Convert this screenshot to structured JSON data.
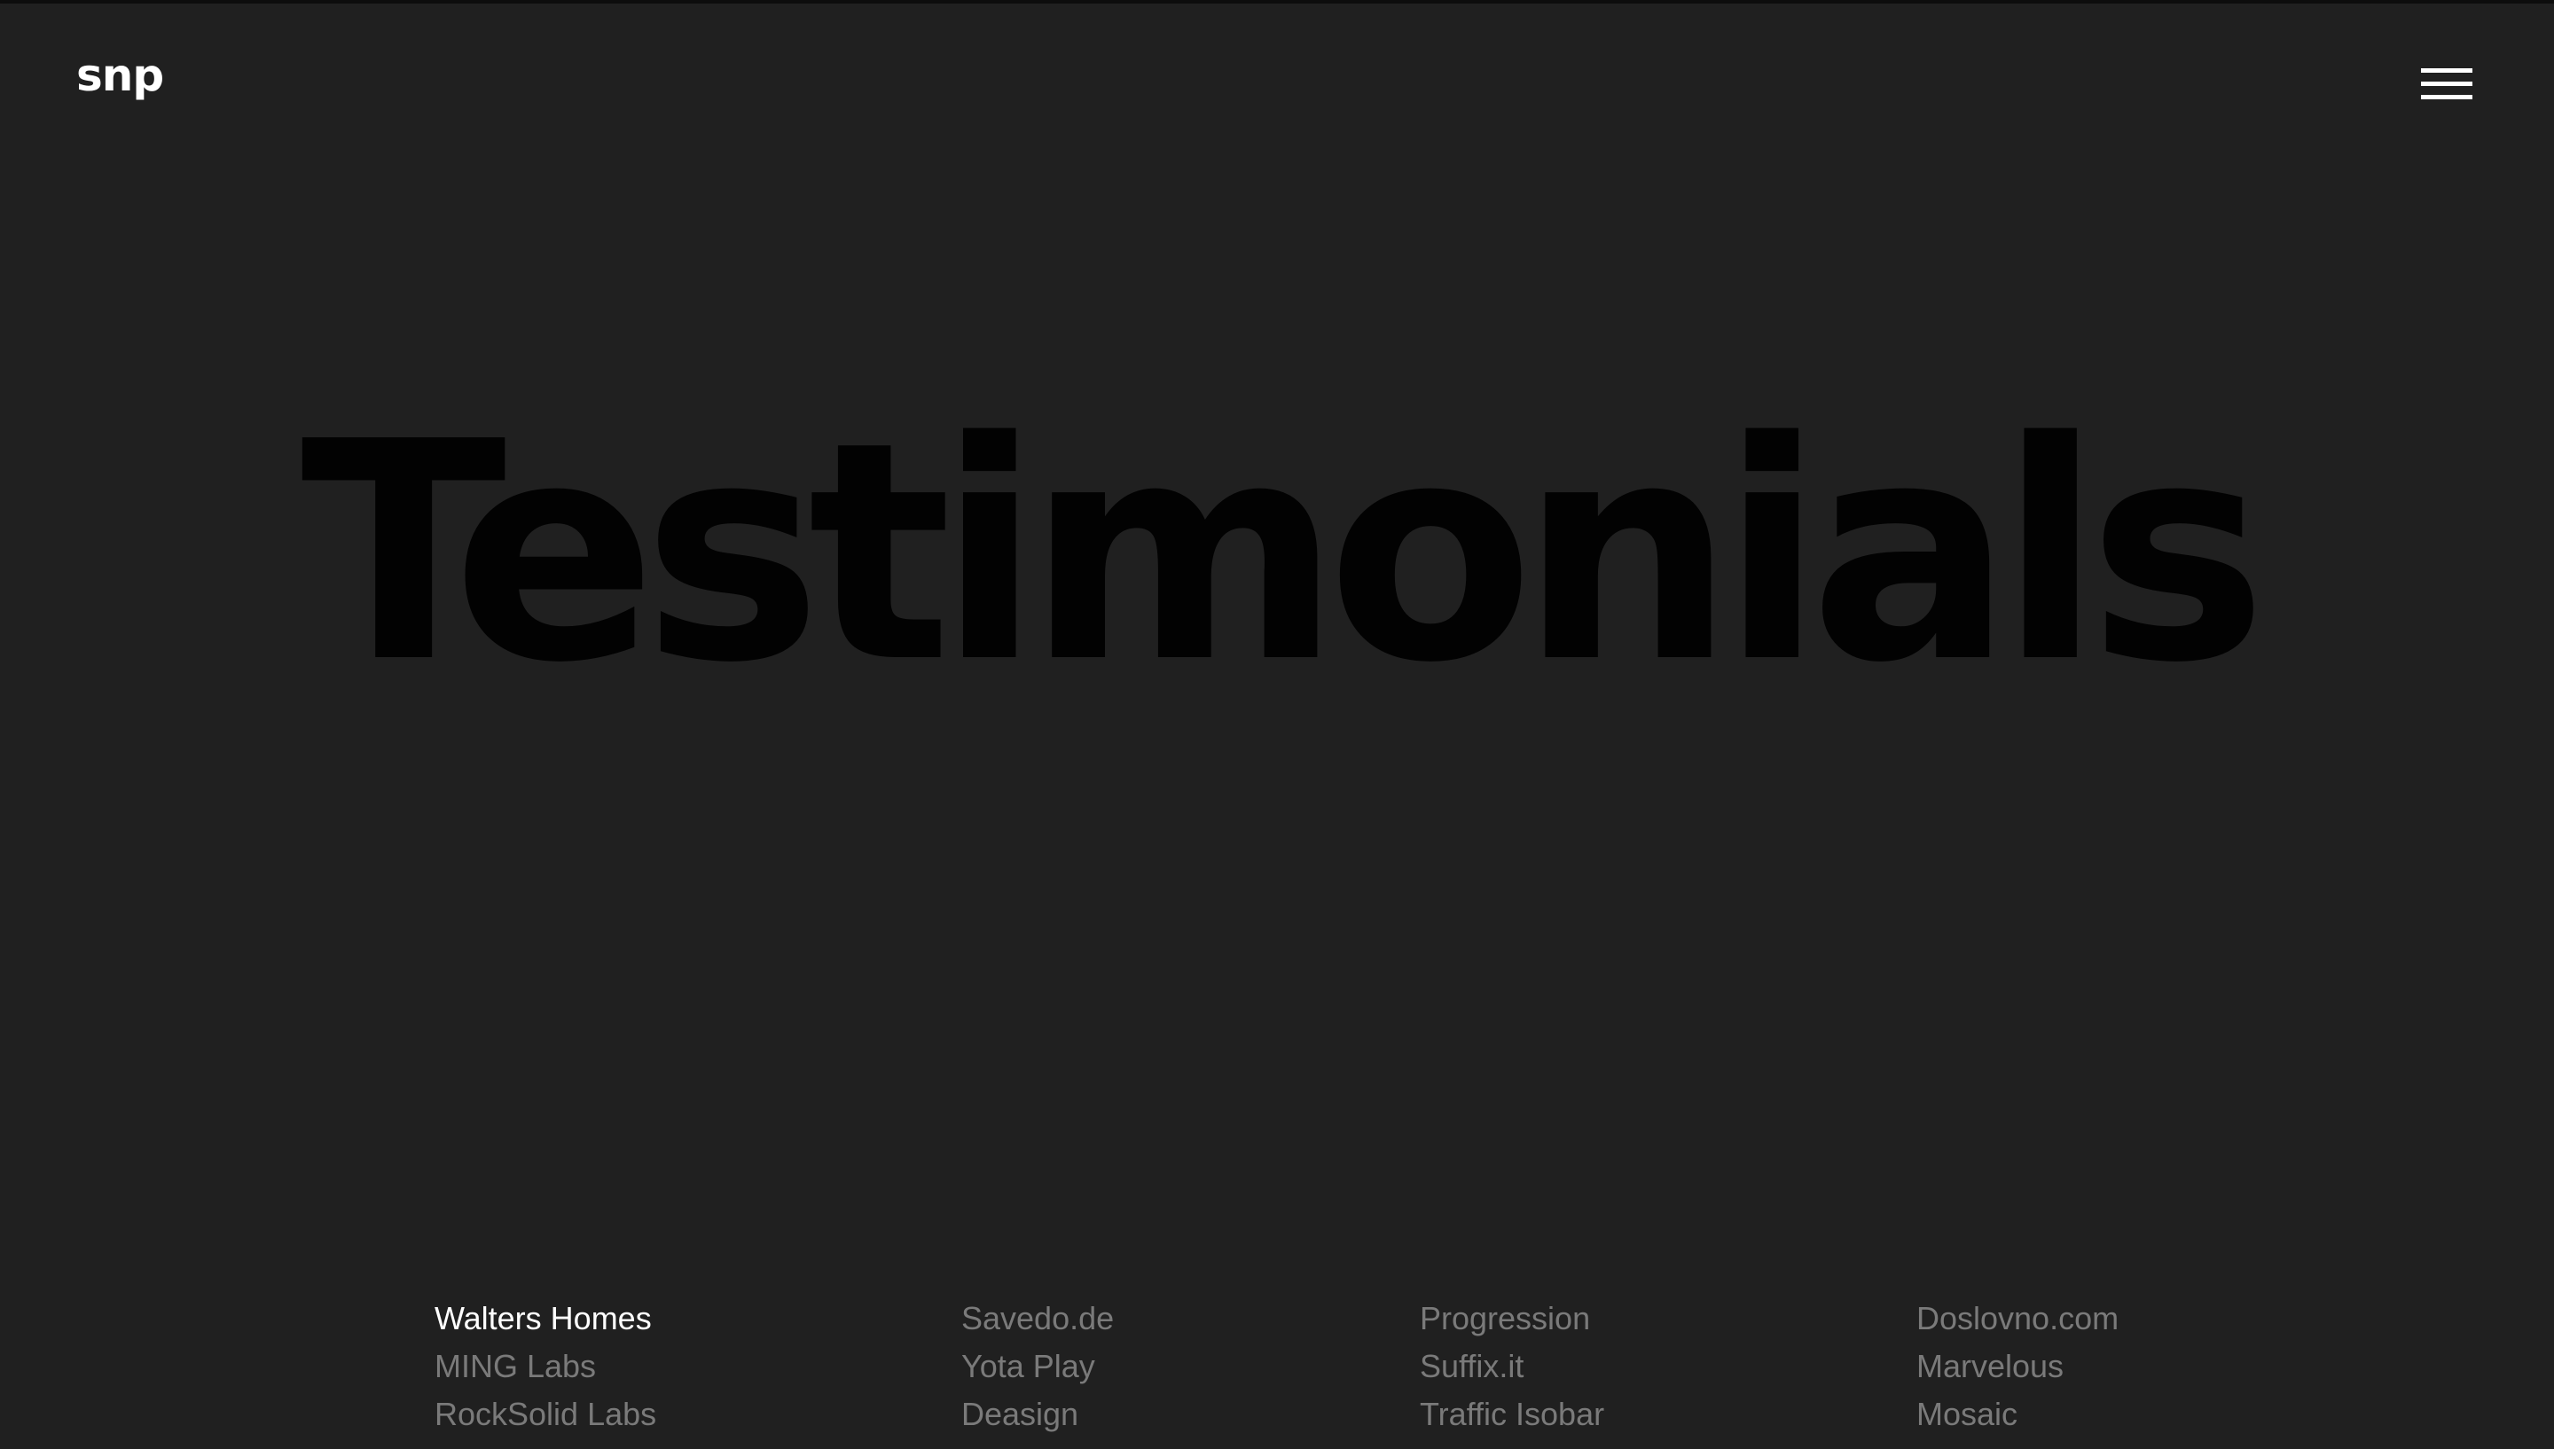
{
  "header": {
    "logo": "snp",
    "menu_icon": "hamburger-menu-icon"
  },
  "hero": {
    "title": "Testimonials"
  },
  "clients": {
    "active": "Walters Homes",
    "columns": [
      [
        "Walters Homes",
        "MING Labs",
        "RockSolid Labs"
      ],
      [
        "Savedo.de",
        "Yota Play",
        "Deasign"
      ],
      [
        "Progression",
        "Suffix.it",
        "Traffic Isobar"
      ],
      [
        "Doslovno.com",
        "Marvelous",
        "Mosaic"
      ]
    ]
  },
  "colors": {
    "background": "#202020",
    "title": "#020202",
    "active_link": "#ffffff",
    "inactive_link": "#7a7a7a"
  }
}
